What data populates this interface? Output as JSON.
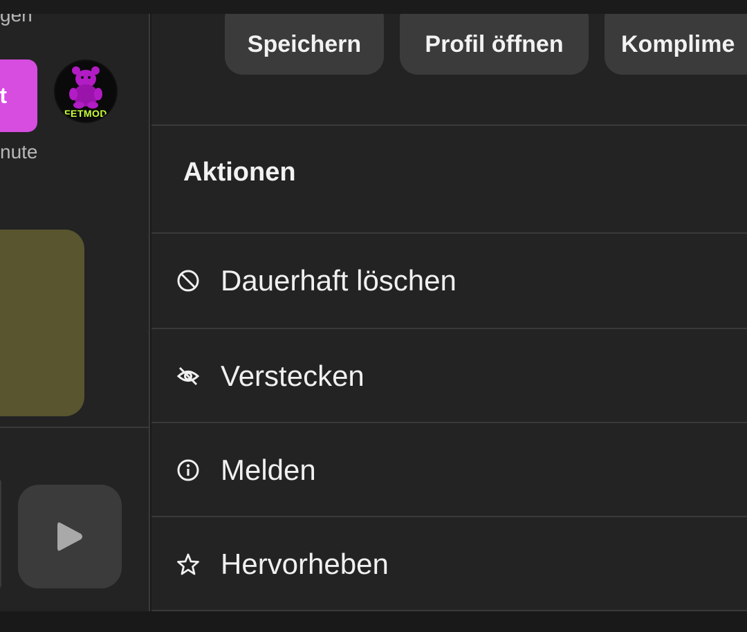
{
  "left_panel": {
    "top_text": "gen",
    "pink_button_label": "t",
    "avatar_text": "FETMOD",
    "mid_text": "nute",
    "play_icon": "play-icon"
  },
  "quick_actions": {
    "save_label": "Speichern",
    "open_profile_label": "Profil öffnen",
    "compliment_label": "Komplime"
  },
  "actions_section": {
    "title": "Aktionen",
    "items": [
      {
        "label": "Dauerhaft löschen",
        "icon": "block-icon"
      },
      {
        "label": "Verstecken",
        "icon": "eye-off-icon"
      },
      {
        "label": "Melden",
        "icon": "info-icon"
      },
      {
        "label": "Hervorheben",
        "icon": "star-icon"
      }
    ]
  },
  "colors": {
    "background": "#191919",
    "panel": "#232323",
    "chip": "#3b3b3b",
    "divider": "#3a3a3a",
    "accent_pink": "#d64de0",
    "olive_card": "#58552f",
    "avatar_green": "#c8ff3a",
    "text": "#f0f0f0"
  }
}
